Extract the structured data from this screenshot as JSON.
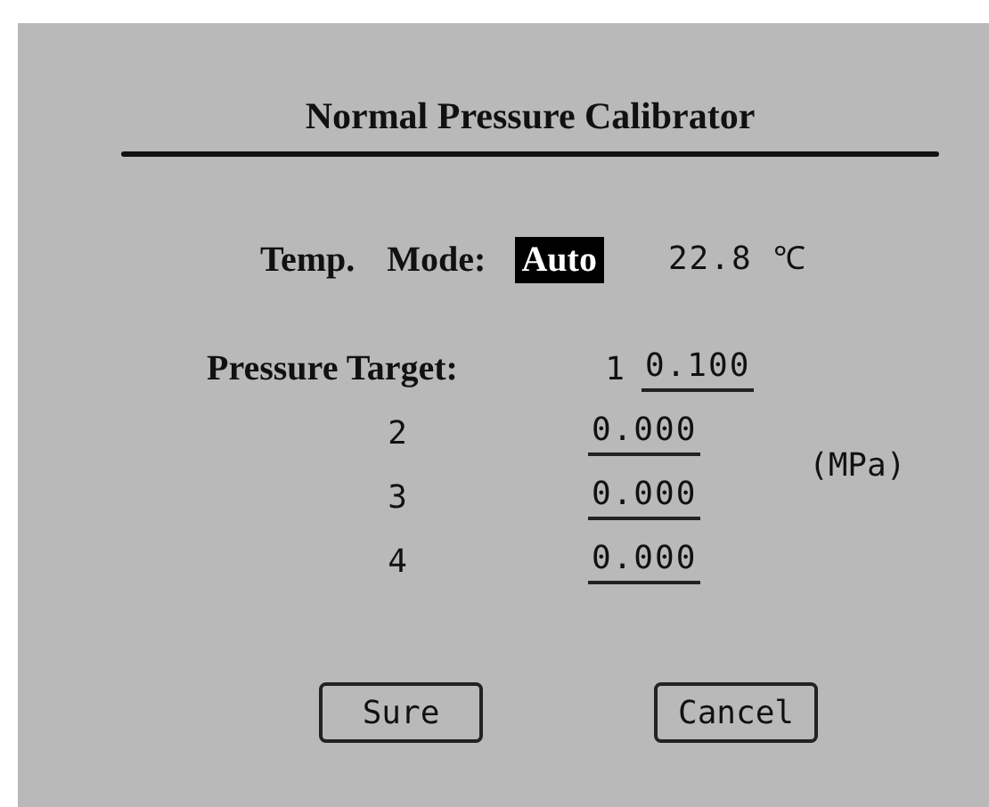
{
  "title": "Normal Pressure Calibrator",
  "temperature": {
    "label": "Temp.",
    "mode_label": "Mode:",
    "mode": {
      "value": "Auto",
      "selected": true
    },
    "reading": "22.8 ℃"
  },
  "pressure_target": {
    "label": "Pressure Target:",
    "unit": "(MPa)",
    "targets": [
      {
        "index": "1",
        "value": "0.100"
      },
      {
        "index": "2",
        "value": "0.000"
      },
      {
        "index": "3",
        "value": "0.000"
      },
      {
        "index": "4",
        "value": "0.000"
      }
    ]
  },
  "buttons": [
    {
      "label": "Sure"
    },
    {
      "label": "Cancel"
    }
  ]
}
